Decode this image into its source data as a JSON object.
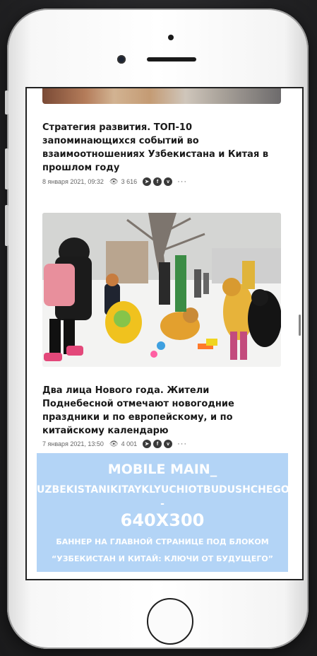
{
  "articles": [
    {
      "headline_lines": [
        "Стратегия развития. ТОП-10",
        "запоминающихся событий во",
        "взаимоотношениях Узбекистана и Китая в",
        "прошлом году"
      ],
      "date": "8 января 2021, 09:32",
      "views": "3 616"
    },
    {
      "headline_lines": [
        "Два лица Нового года. Жители",
        "Поднебесной отмечают новогодние",
        "праздники и по европейскому, и по",
        "китайскому календарю"
      ],
      "date": "7 января 2021, 13:50",
      "views": "4 001"
    }
  ],
  "icons": {
    "views": "eye-icon",
    "share": [
      "telegram-icon",
      "facebook-icon",
      "vk-icon"
    ],
    "more": "more-icon"
  },
  "banner": {
    "line1": "MOBILE MAIN_",
    "line2": "UZBEKISTANIKITAYKLYUCHIOTBUDUSHCHEGO  -",
    "line3": "640X300",
    "line4": "БАННЕР НА ГЛАВНОЙ СТРАНИЦЕ ПОД БЛОКОМ",
    "line5": "“УЗБЕКИСТАН И КИТАЙ: КЛЮЧИ ОТ БУДУЩЕГО”"
  },
  "colors": {
    "banner_bg": "#b3d4f6",
    "banner_text": "#ffffff",
    "headline_text": "#1a1a1a"
  }
}
